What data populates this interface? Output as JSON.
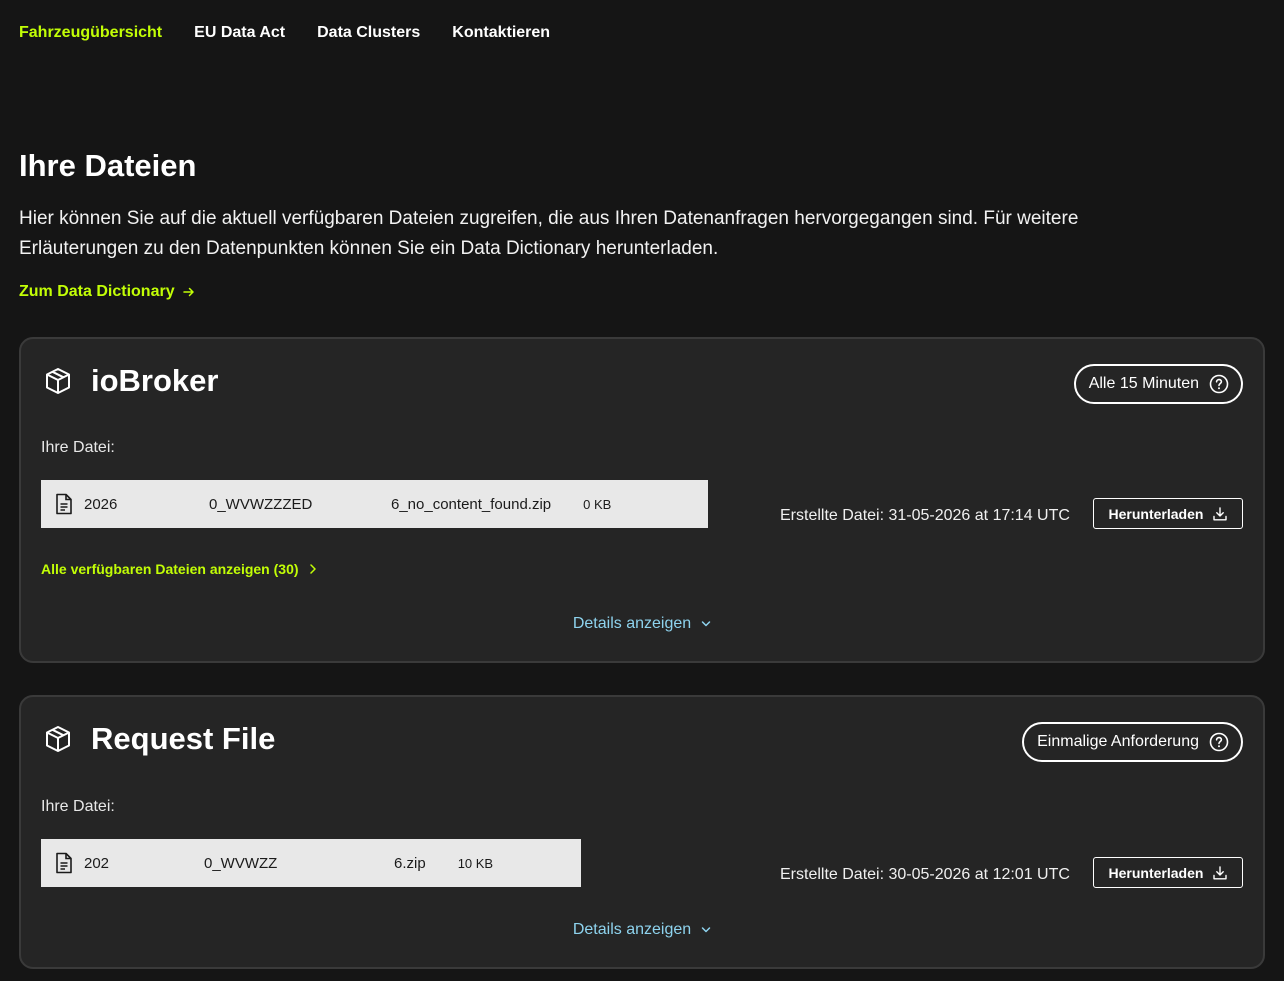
{
  "nav": {
    "items": [
      {
        "label": "Fahrzeugübersicht",
        "active": true
      },
      {
        "label": "EU Data Act",
        "active": false
      },
      {
        "label": "Data Clusters",
        "active": false
      },
      {
        "label": "Kontaktieren",
        "active": false
      }
    ]
  },
  "page": {
    "title": "Ihre Dateien",
    "intro": "Hier können Sie auf die aktuell verfügbaren Dateien zugreifen, die aus Ihren Datenanfragen hervorgegangen sind. Für weitere Erläuterungen zu den Datenpunkten können Sie ein Data Dictionary herunterladen.",
    "dictionary_link": "Zum Data Dictionary"
  },
  "cards": [
    {
      "title": "ioBroker",
      "frequency": "Alle 15 Minuten",
      "file_label": "Ihre Datei:",
      "file": {
        "name_part1": "2026",
        "name_part2": "0_WVWZZZED",
        "name_part3": "6_no_content_found.zip",
        "size": "0 KB"
      },
      "created": "Erstellte Datei: 31-05-2026 at 17:14 UTC",
      "download_label": "Herunterladen",
      "all_files_link": "Alle verfügbaren Dateien anzeigen (30)",
      "details_label": "Details anzeigen"
    },
    {
      "title": "Request File",
      "frequency": "Einmalige Anforderung",
      "file_label": "Ihre Datei:",
      "file": {
        "name_part1": "202",
        "name_part2": "0_WVWZZ",
        "name_part3": "6.zip",
        "size": "10 KB"
      },
      "created": "Erstellte Datei: 30-05-2026 at 12:01 UTC",
      "download_label": "Herunterladen",
      "details_label": "Details anzeigen"
    }
  ],
  "colors": {
    "background": "#151515",
    "card": "#252525",
    "accent_green": "#c2fe06",
    "link_blue": "#8ed3ee",
    "file_box": "#e8e8e8"
  },
  "icons": [
    "cube-icon",
    "help-circle-icon",
    "document-icon",
    "download-icon",
    "arrow-right-icon",
    "chevron-right-icon",
    "chevron-down-icon"
  ]
}
